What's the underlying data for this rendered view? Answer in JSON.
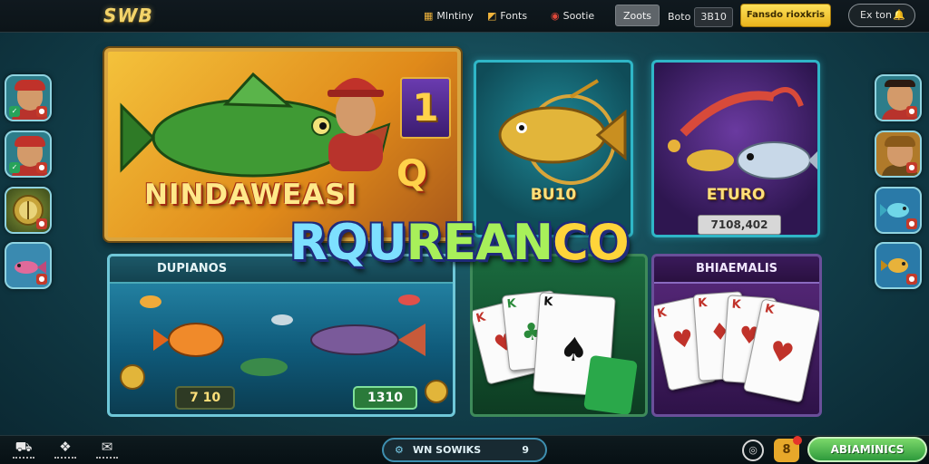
{
  "topbar": {
    "logo": "SWB",
    "nav": [
      {
        "label": "Mlntiny",
        "icon": "lottery-icon"
      },
      {
        "label": "Fonts",
        "icon": "puzzle-icon"
      },
      {
        "label": "Sootie",
        "icon": "slot-icon"
      },
      {
        "label": "Zoots",
        "icon": "zoots-icon"
      },
      {
        "label": "Boto",
        "value": "3B10"
      }
    ],
    "cta": "Fansdo rioxkris",
    "account": "Ex ton"
  },
  "hero": {
    "number": "1",
    "title": "NINDAWEASI",
    "badge": "Q"
  },
  "tiles": {
    "fish": {
      "label": "BU10"
    },
    "euro": {
      "label": "ETURO",
      "amount": "7108,402"
    },
    "fishing": {
      "header": "DUPIANOS",
      "left_value": "7 10",
      "right_value": "1310"
    },
    "cards2": {
      "header": "BHIAEMALIS"
    }
  },
  "banner": {
    "part1": "RQU",
    "part2": "REAN",
    "part3": "CO"
  },
  "bottombar": {
    "center_label": "WN SOWIKS",
    "center_count": "9",
    "coin_label": "8",
    "green_cta": "ABIAMINICS"
  },
  "colors": {
    "accent_yellow": "#f3d46b",
    "cta_yellow": "#fde15a",
    "teal_border": "#2fb6c7",
    "green_cta": "#2e9a3c"
  }
}
